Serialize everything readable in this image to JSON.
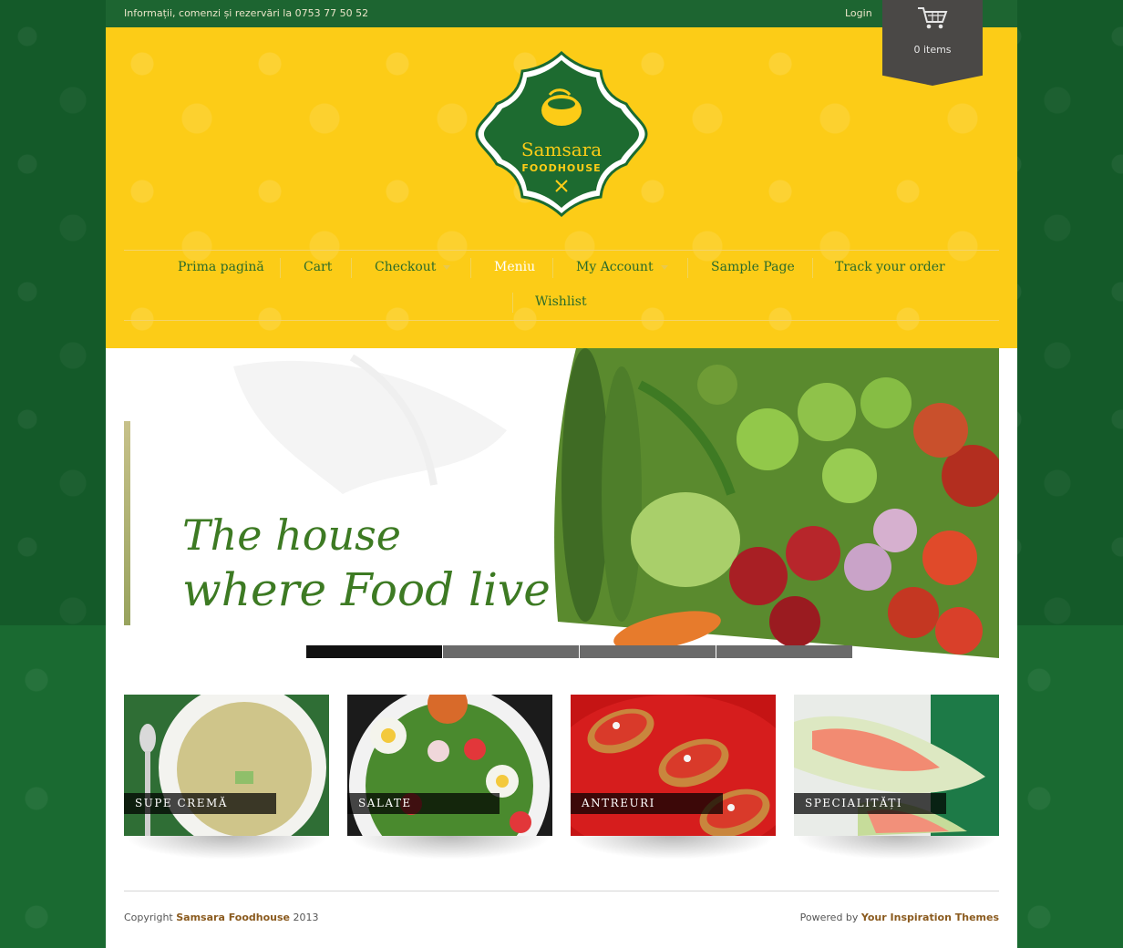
{
  "topbar": {
    "info": "Informații, comenzi și rezervări la 0753 77 50 52",
    "login": "Login"
  },
  "cart": {
    "count_label": "0 items"
  },
  "logo": {
    "line1": "Samsara",
    "line2": "FOODHOUSE"
  },
  "nav": {
    "items": [
      {
        "label": "Prima pagină"
      },
      {
        "label": "Cart"
      },
      {
        "label": "Checkout"
      },
      {
        "label": "Meniu"
      },
      {
        "label": "My Account"
      },
      {
        "label": "Sample Page"
      },
      {
        "label": "Track your order"
      },
      {
        "label": "Wishlist"
      }
    ]
  },
  "hero": {
    "line1": "The house",
    "line2": "where Food lives"
  },
  "slider": {
    "active_index": 0,
    "count": 4
  },
  "tiles": [
    {
      "label": "SUPE CREMĂ"
    },
    {
      "label": "SALATE"
    },
    {
      "label": "ANTREURI"
    },
    {
      "label": "SPECIALITĂȚI"
    }
  ],
  "footer": {
    "copyright_prefix": "Copyright",
    "copyright_link": "Samsara Foodhouse",
    "copyright_year": "2013",
    "powered_prefix": "Powered by",
    "powered_link": "Your Inspiration Themes"
  },
  "colors": {
    "header_yellow": "#fccc17",
    "brand_green": "#1d6531",
    "nav_text": "#2b6b2a",
    "link_brown": "#8a5a1e"
  }
}
